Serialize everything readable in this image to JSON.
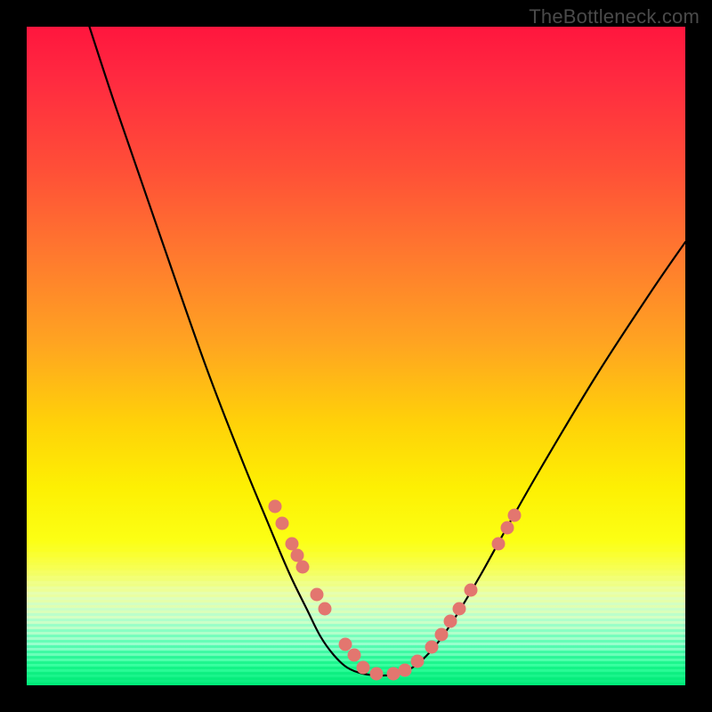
{
  "watermark": "TheBottleneck.com",
  "colors": {
    "background": "#000000",
    "curve_stroke": "#000000",
    "dot_fill": "#e3766f",
    "gradient_top": "#ff163e",
    "gradient_bottom": "#00eb7a"
  },
  "chart_data": {
    "type": "line",
    "title": "",
    "xlabel": "",
    "ylabel": "",
    "xlim": [
      0,
      740
    ],
    "ylim_screen_y": [
      0,
      740
    ],
    "note": "Coordinates are in plot-area pixel space (740×740), y increases downward. The curve is an asymmetric V / bottleneck shape; dots mark highlighted sample points along the curve.",
    "series": [
      {
        "name": "bottleneck-curve",
        "kind": "path",
        "points": [
          [
            64,
            -20
          ],
          [
            100,
            90
          ],
          [
            150,
            235
          ],
          [
            200,
            378
          ],
          [
            240,
            482
          ],
          [
            270,
            555
          ],
          [
            295,
            614
          ],
          [
            315,
            655
          ],
          [
            330,
            685
          ],
          [
            345,
            706
          ],
          [
            360,
            720
          ],
          [
            378,
            727
          ],
          [
            400,
            729
          ],
          [
            418,
            727
          ],
          [
            432,
            721
          ],
          [
            448,
            708
          ],
          [
            465,
            688
          ],
          [
            485,
            658
          ],
          [
            510,
            616
          ],
          [
            540,
            562
          ],
          [
            580,
            492
          ],
          [
            640,
            392
          ],
          [
            700,
            300
          ],
          [
            740,
            242
          ]
        ]
      },
      {
        "name": "dots-left",
        "kind": "scatter",
        "points": [
          [
            279,
            539
          ],
          [
            287,
            558
          ],
          [
            298,
            581
          ],
          [
            304,
            594
          ],
          [
            310,
            607
          ],
          [
            326,
            638
          ],
          [
            335,
            654
          ],
          [
            358,
            694
          ],
          [
            368,
            706
          ]
        ]
      },
      {
        "name": "dots-bottom",
        "kind": "scatter",
        "points": [
          [
            378,
            720
          ],
          [
            393,
            727
          ],
          [
            412,
            727
          ],
          [
            425,
            723
          ]
        ]
      },
      {
        "name": "dots-right",
        "kind": "scatter",
        "points": [
          [
            439,
            713
          ],
          [
            455,
            697
          ],
          [
            466,
            683
          ],
          [
            476,
            668
          ],
          [
            486,
            654
          ],
          [
            499,
            633
          ],
          [
            530,
            581
          ],
          [
            540,
            563
          ],
          [
            548,
            549
          ]
        ]
      }
    ]
  }
}
